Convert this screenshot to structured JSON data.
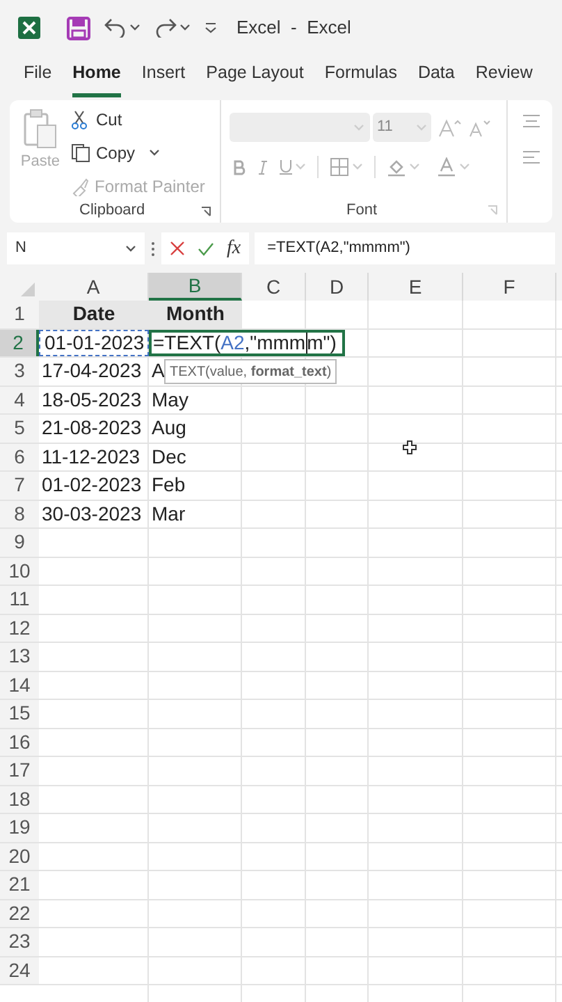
{
  "title_bar": {
    "title": "Excel  -  Excel"
  },
  "ribbon_tabs": [
    {
      "label": "File",
      "selected": false
    },
    {
      "label": "Home",
      "selected": true
    },
    {
      "label": "Insert",
      "selected": false
    },
    {
      "label": "Page Layout",
      "selected": false
    },
    {
      "label": "Formulas",
      "selected": false
    },
    {
      "label": "Data",
      "selected": false
    },
    {
      "label": "Review",
      "selected": false
    }
  ],
  "clipboard": {
    "paste": "Paste",
    "cut": "Cut",
    "copy": "Copy",
    "format_painter": "Format Painter",
    "group_label": "Clipboard"
  },
  "font_group": {
    "font_size": "11",
    "group_label": "Font"
  },
  "formula_bar": {
    "name_box": "N",
    "function_button": "fx",
    "formula": "=TEXT(A2,\"mmmm\")"
  },
  "columns": [
    {
      "label": "A",
      "selected": false
    },
    {
      "label": "B",
      "selected": true
    },
    {
      "label": "C",
      "selected": false
    },
    {
      "label": "D",
      "selected": false
    },
    {
      "label": "E",
      "selected": false
    },
    {
      "label": "F",
      "selected": false
    }
  ],
  "rows": [
    {
      "number": "1",
      "selected": false,
      "cells": [
        {
          "kind": "header",
          "text": "Date"
        },
        {
          "kind": "header",
          "text": "Month"
        }
      ]
    },
    {
      "number": "2",
      "selected": true,
      "cells": [
        {
          "kind": "ref",
          "text": "01-01-2023"
        },
        {
          "kind": "edit",
          "parts": [
            {
              "kind": "text",
              "text": "=TEXT("
            },
            {
              "kind": "ref",
              "text": "A2"
            },
            {
              "kind": "text",
              "text": ",\"mmm"
            },
            {
              "kind": "caret"
            },
            {
              "kind": "text",
              "text": "m\")"
            }
          ]
        }
      ]
    },
    {
      "number": "3",
      "selected": false,
      "cells": [
        {
          "kind": "plain",
          "text": "17-04-2023"
        },
        {
          "kind": "plain",
          "text": "A"
        }
      ]
    },
    {
      "number": "4",
      "selected": false,
      "cells": [
        {
          "kind": "plain",
          "text": "18-05-2023"
        },
        {
          "kind": "plain",
          "text": "May"
        }
      ]
    },
    {
      "number": "5",
      "selected": false,
      "cells": [
        {
          "kind": "plain",
          "text": "21-08-2023"
        },
        {
          "kind": "plain",
          "text": "Aug"
        }
      ]
    },
    {
      "number": "6",
      "selected": false,
      "cells": [
        {
          "kind": "plain",
          "text": "11-12-2023"
        },
        {
          "kind": "plain",
          "text": "Dec"
        }
      ]
    },
    {
      "number": "7",
      "selected": false,
      "cells": [
        {
          "kind": "plain",
          "text": "01-02-2023"
        },
        {
          "kind": "plain",
          "text": "Feb"
        }
      ]
    },
    {
      "number": "8",
      "selected": false,
      "cells": [
        {
          "kind": "plain",
          "text": "30-03-2023"
        },
        {
          "kind": "plain",
          "text": "Mar"
        }
      ]
    },
    {
      "number": "9",
      "selected": false
    },
    {
      "number": "10",
      "selected": false
    },
    {
      "number": "11",
      "selected": false
    },
    {
      "number": "12",
      "selected": false
    },
    {
      "number": "13",
      "selected": false
    },
    {
      "number": "14",
      "selected": false
    },
    {
      "number": "15",
      "selected": false
    },
    {
      "number": "16",
      "selected": false
    },
    {
      "number": "17",
      "selected": false
    },
    {
      "number": "18",
      "selected": false
    },
    {
      "number": "19",
      "selected": false
    },
    {
      "number": "20",
      "selected": false
    },
    {
      "number": "21",
      "selected": false
    },
    {
      "number": "22",
      "selected": false
    },
    {
      "number": "23",
      "selected": false
    },
    {
      "number": "24",
      "selected": false
    }
  ],
  "tooltip": "TEXT(value, **format_text**)"
}
